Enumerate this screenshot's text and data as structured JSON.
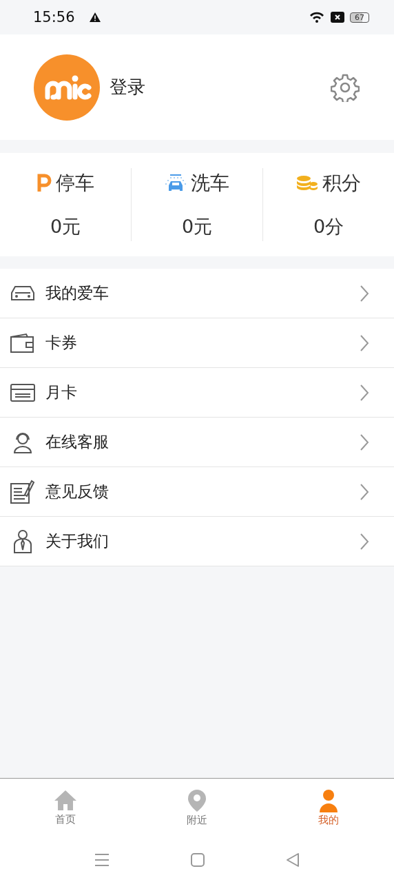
{
  "status_bar": {
    "time": "15:56",
    "battery": "67"
  },
  "profile": {
    "login": "登录"
  },
  "stats": [
    {
      "kind": "parking",
      "label": "停车",
      "value": "0元"
    },
    {
      "kind": "wash",
      "label": "洗车",
      "value": "0元"
    },
    {
      "kind": "points",
      "label": "积分",
      "value": "0分"
    }
  ],
  "menu": [
    {
      "kind": "car",
      "label": "我的爱车"
    },
    {
      "kind": "wallet",
      "label": "卡券"
    },
    {
      "kind": "card",
      "label": "月卡"
    },
    {
      "kind": "service",
      "label": "在线客服"
    },
    {
      "kind": "feedback",
      "label": "意见反馈"
    },
    {
      "kind": "about",
      "label": "关于我们"
    }
  ],
  "tabs": [
    {
      "kind": "home",
      "label": "首页",
      "selected": false
    },
    {
      "kind": "nearby",
      "label": "附近",
      "selected": false
    },
    {
      "kind": "me",
      "label": "我的",
      "selected": true
    }
  ]
}
